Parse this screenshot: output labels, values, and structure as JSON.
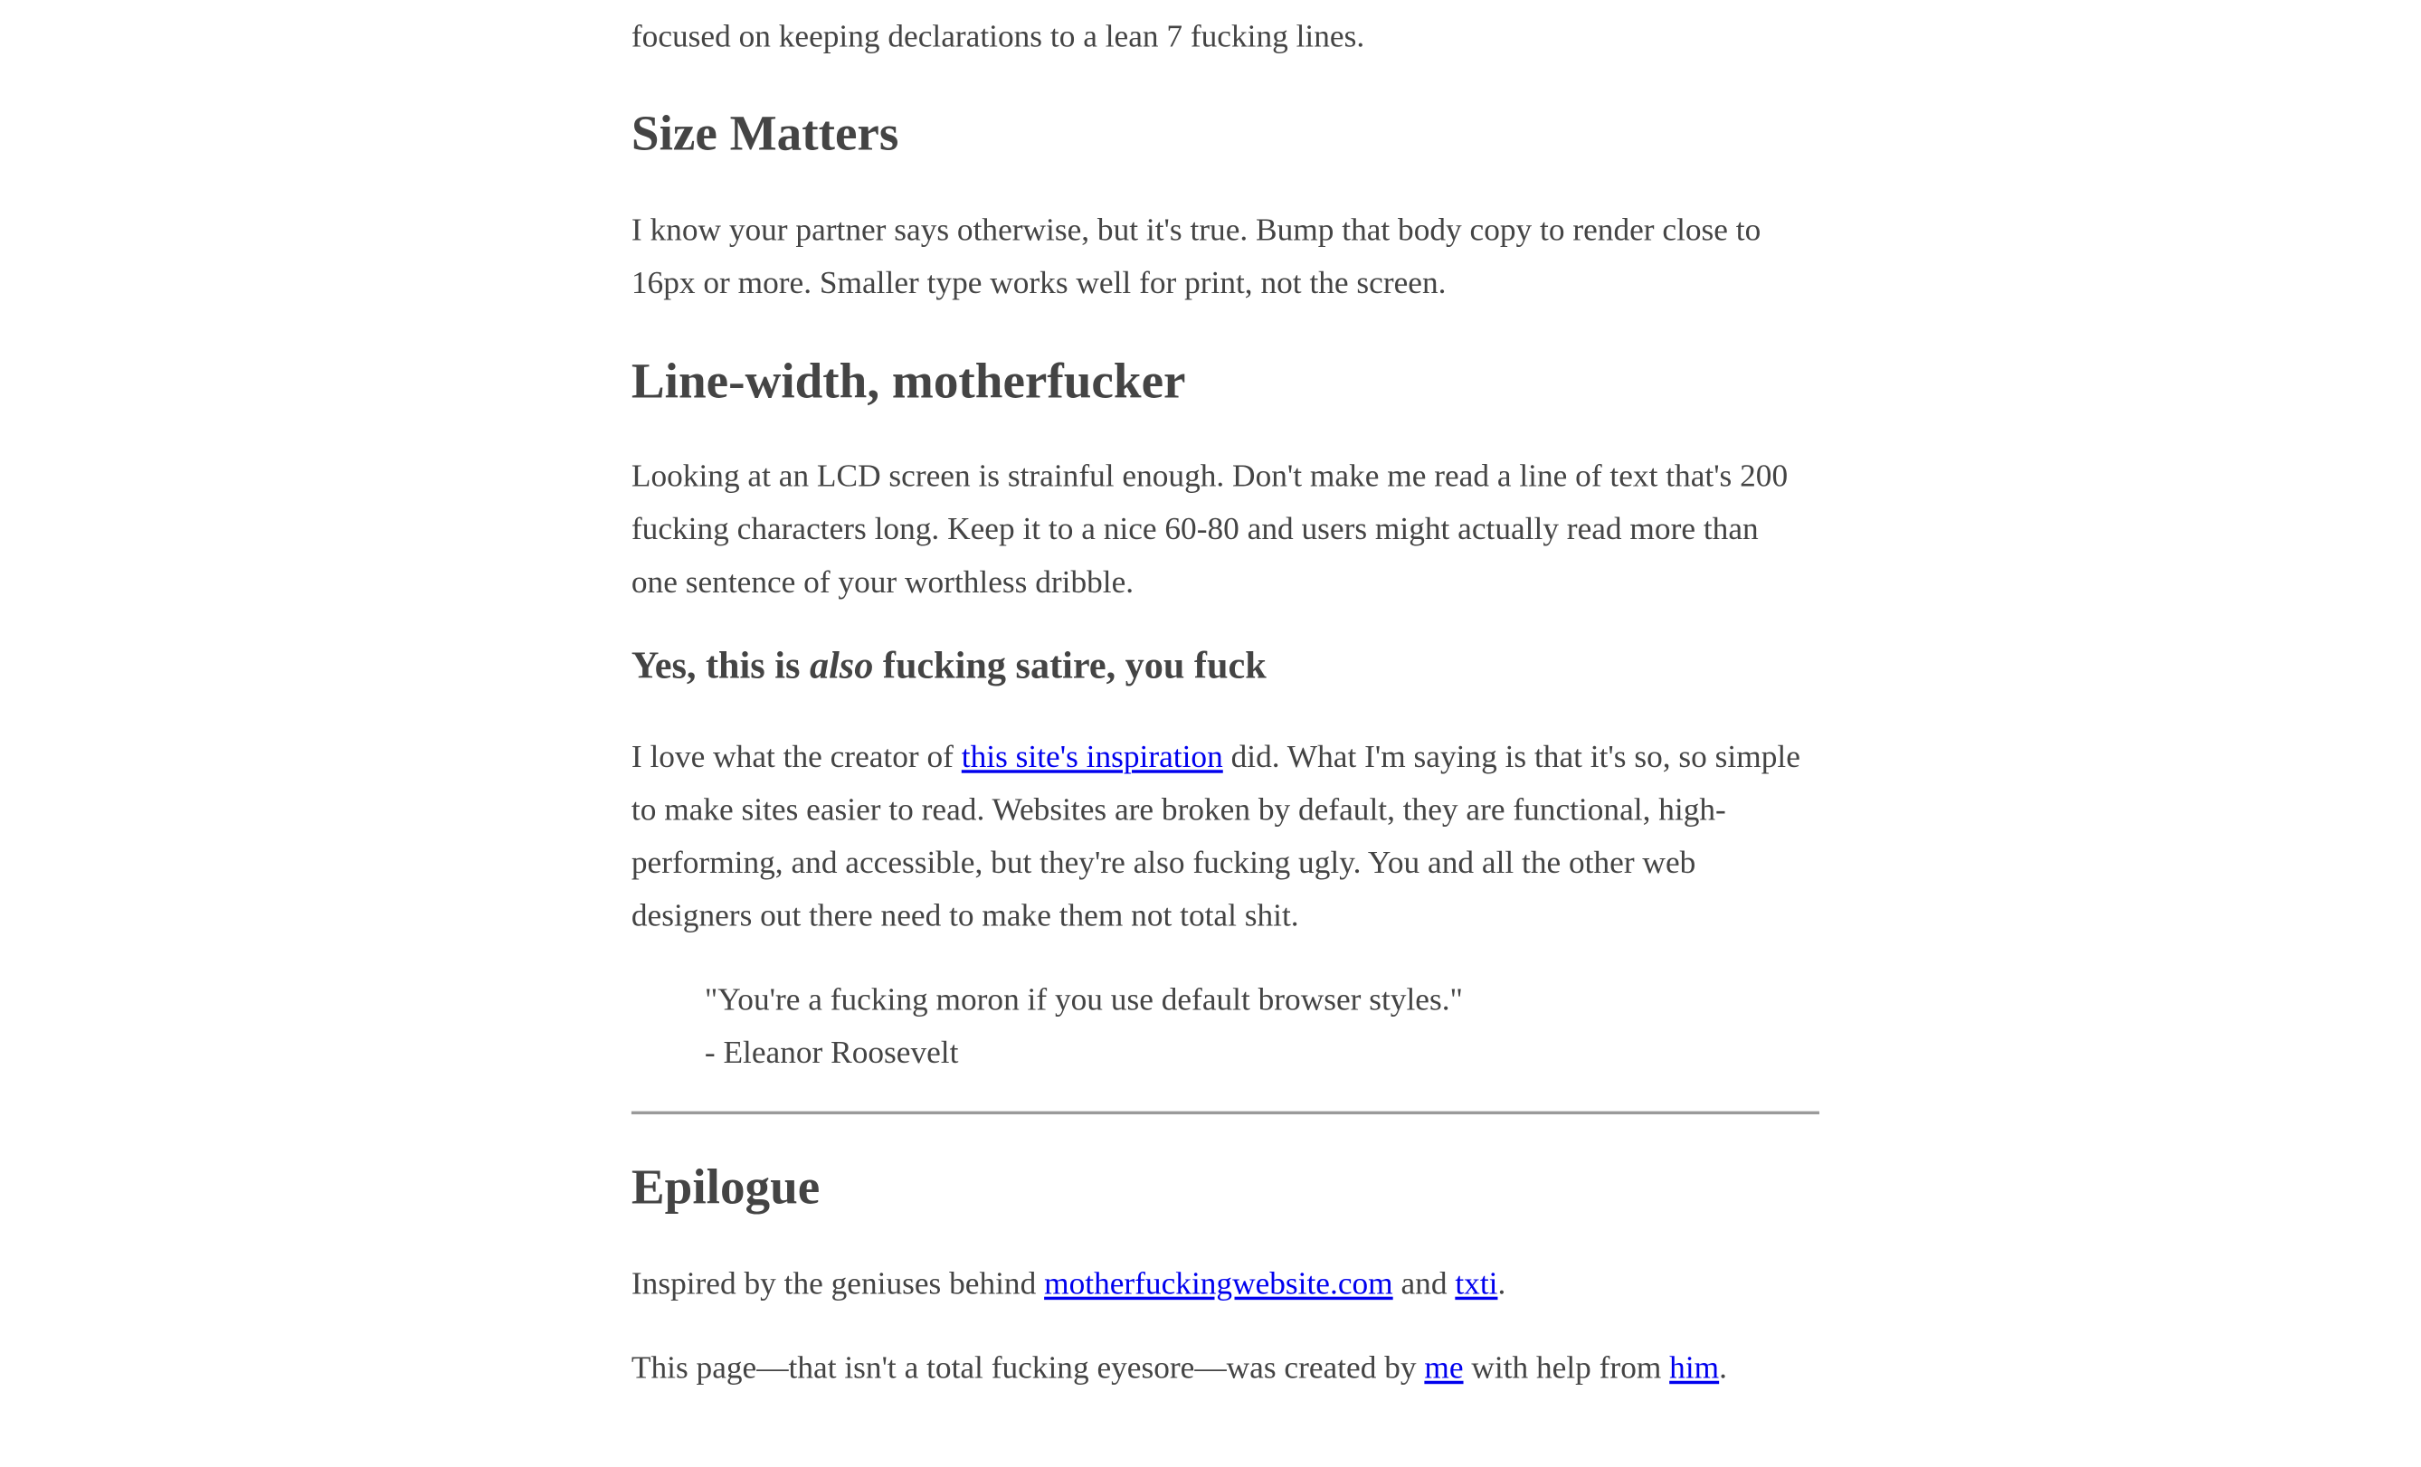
{
  "top_fragment": "focused on keeping declarations to a lean 7 fucking lines.",
  "size_section": {
    "heading": "Size Matters",
    "body": "I know your partner says otherwise, but it's true. Bump that body copy to render close to 16px or more. Smaller type works well for print, not the screen."
  },
  "line_width_section": {
    "heading": "Line-width, motherfucker",
    "body": "Looking at an LCD screen is strainful enough. Don't make me read a line of text that's 200 fucking characters long. Keep it to a nice 60-80 and users might actually read more than one sentence of your worthless dribble."
  },
  "satire_section": {
    "heading_before": "Yes, this is ",
    "heading_emphasis": "also",
    "heading_after": " fucking satire, you fuck",
    "body_before_link": "I love what the creator of ",
    "inspiration_link": "this site's inspiration",
    "body_after_link": " did. What I'm saying is that it's so, so simple to make sites easier to read. Websites are broken by default, they are functional, high-performing, and accessible, but they're also fucking ugly. You and all the other web designers out there need to make them not total shit.",
    "quote_text": "\"You're a fucking moron if you use default browser styles.\"",
    "quote_author": "- Eleanor Roosevelt"
  },
  "epilogue_section": {
    "heading": "Epilogue",
    "inspired_before": "Inspired by the geniuses behind ",
    "motherfucking_link": "motherfuckingwebsite.com",
    "inspired_middle": " and ",
    "txti_link": "txti",
    "inspired_after": ".",
    "credit_before": "This page—that isn't a total fucking eyesore—was created by ",
    "me_link": "me",
    "credit_middle": " with help from ",
    "him_link": "him",
    "credit_after": "."
  },
  "colors": {
    "text": "#444444",
    "link": "#0000ee",
    "rule": "#9a9a9a",
    "background": "#ffffff"
  }
}
